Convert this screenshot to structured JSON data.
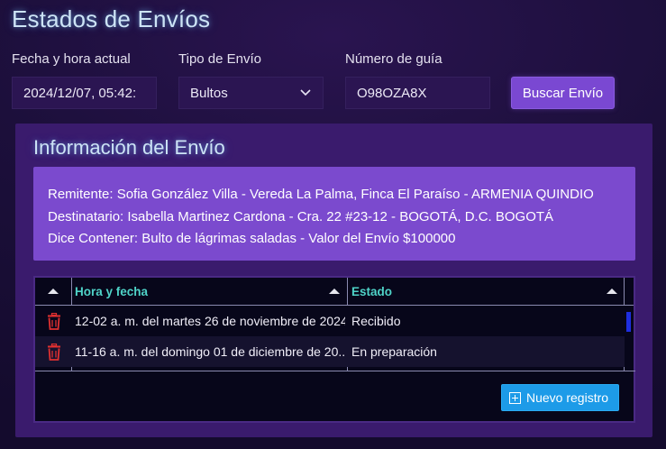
{
  "page": {
    "title": "Estados de Envíos"
  },
  "form": {
    "datetime_label": "Fecha y hora actual",
    "datetime_value": "2024/12/07, 05:42:",
    "type_label": "Tipo de Envío",
    "type_value": "Bultos",
    "guide_label": "Número de guía",
    "guide_value": "O98OZA8X",
    "search_button": "Buscar Envío"
  },
  "panel": {
    "title": "Información del Envío",
    "sender": "Remitente: Sofia González Villa - Vereda La Palma, Finca El Paraíso - ARMENIA QUINDIO",
    "recipient": "Destinatario: Isabella Martinez Cardona - Cra. 22 #23-12 - BOGOTÁ, D.C. BOGOTÁ",
    "contents": "Dice Contener: Bulto de lágrimas saladas - Valor del Envío $100000"
  },
  "grid": {
    "columns": [
      "Hora y fecha",
      "Estado"
    ],
    "rows": [
      {
        "datetime": "12-02 a. m. del martes 26 de noviembre de 2024",
        "status": "Recibido"
      },
      {
        "datetime": "11-16 a. m. del domingo 01 de diciembre de 20...",
        "status": "En preparación"
      }
    ],
    "new_button": "Nuevo registro"
  },
  "icons": {
    "delete": "trash-icon",
    "sort": "sort-asc-icon",
    "dropdown": "chevron-down-icon",
    "add": "plus-square-icon"
  },
  "colors": {
    "accent": "#7a48d2",
    "info_box": "#7b4ace",
    "header_text": "#4fd3c8",
    "delete": "#e03030",
    "new_button": "#1d9be8"
  }
}
